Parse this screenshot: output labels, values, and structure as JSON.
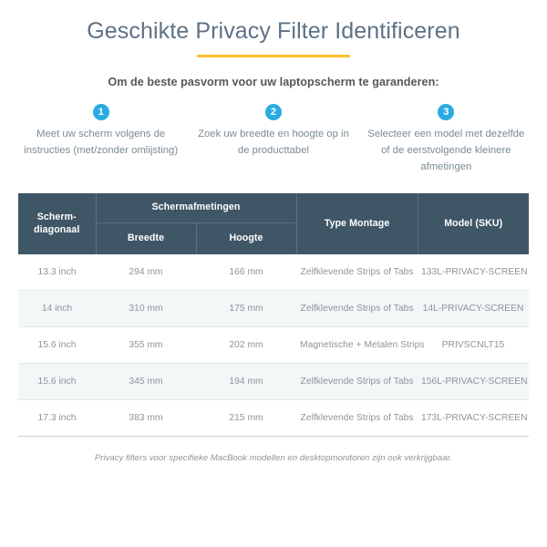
{
  "header": {
    "title": "Geschikte Privacy Filter Identificeren",
    "accent_color": "#fbc02d",
    "title_color": "#5d7285",
    "subtitle": "Om de beste pasvorm voor uw laptopscherm te garanderen:"
  },
  "steps": {
    "badge_color": "#29abe2",
    "items": [
      {
        "number": "1",
        "text": "Meet uw scherm volgens de instructies (met/zonder omlijsting)"
      },
      {
        "number": "2",
        "text": "Zoek uw breedte en hoogte op in de producttabel"
      },
      {
        "number": "3",
        "text": "Selecteer een model met dezelfde of de eerstvolgende kleinere afmetingen"
      }
    ]
  },
  "table": {
    "header_bg": "#3f5667",
    "header": {
      "diagonaal": "Scherm-diagonaal",
      "group_afmetingen": "Schermafmetingen",
      "breedte": "Breedte",
      "hoogte": "Hoogte",
      "montage": "Type Montage",
      "model": "Model (SKU)"
    },
    "rows": [
      {
        "diagonaal": "13.3 inch",
        "breedte": "294 mm",
        "hoogte": "166 mm",
        "montage": "Zelfklevende Strips of Tabs",
        "model": "133L-PRIVACY-SCREEN"
      },
      {
        "diagonaal": "14 inch",
        "breedte": "310 mm",
        "hoogte": "175 mm",
        "montage": "Zelfklevende Strips of Tabs",
        "model": "14L-PRIVACY-SCREEN"
      },
      {
        "diagonaal": "15.6 inch",
        "breedte": "355 mm",
        "hoogte": "202 mm",
        "montage": "Magnetische + Metalen Strips",
        "model": "PRIVSCNLT15"
      },
      {
        "diagonaal": "15.6 inch",
        "breedte": "345 mm",
        "hoogte": "194 mm",
        "montage": "Zelfklevende Strips of Tabs",
        "model": "156L-PRIVACY-SCREEN"
      },
      {
        "diagonaal": "17.3 inch",
        "breedte": "383 mm",
        "hoogte": "215 mm",
        "montage": "Zelfklevende Strips of Tabs",
        "model": "173L-PRIVACY-SCREEN"
      }
    ]
  },
  "footnote": "Privacy filters voor specifieke MacBook modellen en desktopmonitoren zijn ook verkrijgbaar."
}
